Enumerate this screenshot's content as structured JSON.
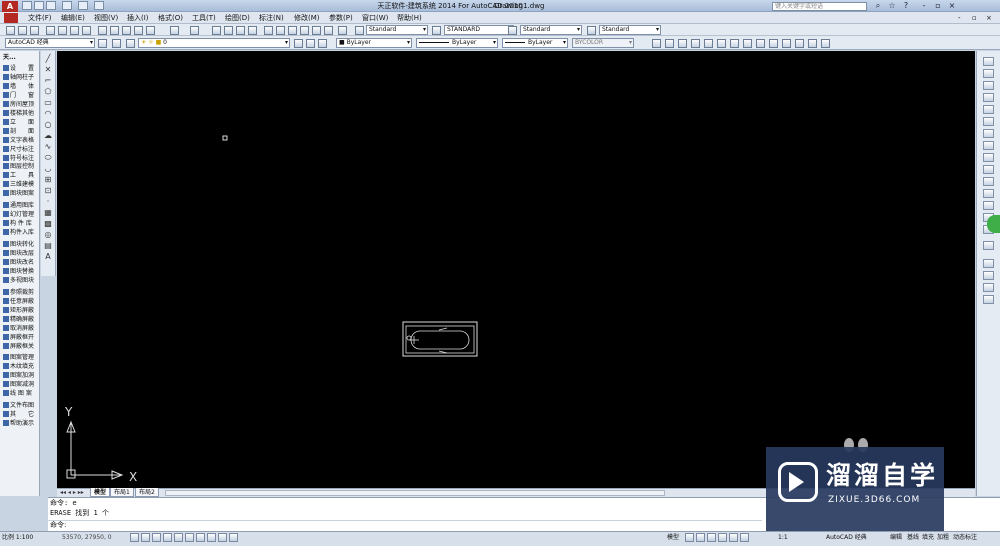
{
  "title_bar": {
    "app_icon": "A",
    "title": "天正软件-建筑系统 2014  For AutoCAD 2010",
    "drawing": "Drawing1.dwg",
    "search_placeholder": "键入关键字或短语",
    "minimize": "-",
    "restore": "▫",
    "close": "×"
  },
  "menu": [
    "文件(F)",
    "编辑(E)",
    "视图(V)",
    "插入(I)",
    "格式(O)",
    "工具(T)",
    "绘图(D)",
    "标注(N)",
    "修改(M)",
    "参数(P)",
    "窗口(W)",
    "帮助(H)"
  ],
  "styles_toolbar": {
    "text_style": "Standard",
    "dim_style": "STANDARD",
    "table_style": "Standard",
    "mleader_style": "Standard"
  },
  "properties_toolbar": {
    "workspace": "AutoCAD 经典",
    "layer": "0",
    "color": "ByLayer",
    "linetype": "ByLayer",
    "lineweight": "ByLayer",
    "plotstyle": "BYCOLOR"
  },
  "left_panel": {
    "header": "天...",
    "items": [
      "设　　置",
      "轴网柱子",
      "墙　　体",
      "门　　窗",
      "房间屋顶",
      "楼梯其他",
      "立　　面",
      "剖　　面",
      "文字表格",
      "尺寸标注",
      "符号标注",
      "图层控制",
      "工　　具",
      "三维建模",
      "图块图案",
      "通用图库",
      "幻灯管理",
      "构 件 库",
      "构件入库",
      "图块转化",
      "图块改层",
      "图块改名",
      "图块替换",
      "多视图块",
      "参照裁剪",
      "任意屏蔽",
      "矩形屏蔽",
      "精确屏蔽",
      "取消屏蔽",
      "屏蔽框开",
      "屏蔽框关",
      "图案管理",
      "木纹填充",
      "图案加洞",
      "图案减洞",
      "线 图 案",
      "文件布图",
      "其　　它",
      "帮助演示"
    ]
  },
  "canvas": {
    "ucs_y": "Y",
    "ucs_x": "X"
  },
  "layout_tabs": [
    "模型",
    "布局1",
    "布局2"
  ],
  "command": {
    "line1": "命令: e",
    "line2": "ERASE 找到 1 个",
    "line3": "命令:",
    "prompt": "命令:"
  },
  "status_bar": {
    "scale": "比例 1:100",
    "coords": "53570, 27950, 0",
    "model": "模型",
    "annotation_scale": "1:1",
    "workspace": "AutoCAD 经典",
    "edit": "编辑",
    "baseline": "基线",
    "fill": "填充",
    "bold": "加粗",
    "dynamic": "动态标注"
  },
  "watermark": {
    "name": "溜溜自学",
    "url": "ZIXUE.3D66.COM"
  }
}
